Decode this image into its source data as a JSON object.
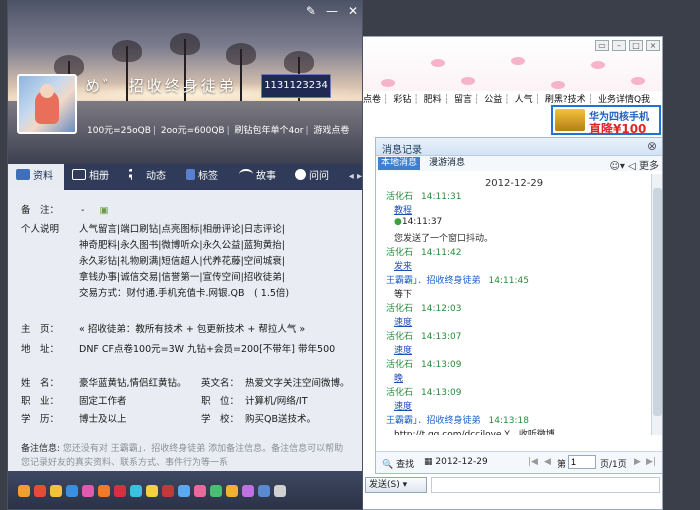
{
  "profile": {
    "nickname": "招收终身徒弟",
    "nick_prefix": "め゛",
    "qq_number": "1131123234",
    "signature": [
      "100元=25oQB",
      "2oo元=600QB",
      "刷钻包年单个4or",
      "游戏点卷"
    ],
    "tabs": [
      {
        "label": "资料",
        "icon": "profile-card-icon"
      },
      {
        "label": "相册",
        "icon": "photo-album-icon"
      },
      {
        "label": "动态",
        "icon": "feed-list-icon"
      },
      {
        "label": "标签",
        "icon": "tag-icon"
      },
      {
        "label": "故事",
        "icon": "story-signal-icon"
      },
      {
        "label": "问问",
        "icon": "question-icon"
      }
    ],
    "fields": {
      "note_label": "备　注：",
      "note_value": "-",
      "bio_label": "个人说明",
      "bio_lines": [
        "人气留言|端口刷钻|点亮图标|相册评论|日志评论|",
        "神奇肥料|永久图书|微博听众|永久公益|蓝狗黄抬|",
        "永久彩钻|礼物刷满|短信超人|代养花藤|空间城衰|",
        "拿钱办事|诚信交易|信誉第一|宣传空间|招收徒弟|",
        "交易方式：财付通.手机充值卡.网银.QB　( 1.5倍)"
      ],
      "homepage_label": "主　页：",
      "homepage_value": "« 招收徒弟：教所有技术 + 包更新技术 + 帮拉人气 »",
      "address_label": "地　址：",
      "address_value": "DNF CF点卷100元=3W 九钻+会员=200[不带年] 带年500",
      "name_label": "姓　名：",
      "name_value": "豪华蓝黄钻,情侣红黄钻。",
      "en_name_label": "英文名：",
      "en_name_value": "热爱文字关注空间微博。",
      "job_label": "职　业：",
      "job_value": "固定工作者",
      "position_label": "职　位：",
      "position_value": "计算机/网络/IT",
      "edu_label": "学　历：",
      "edu_value": "博士及以上",
      "school_label": "学　校：",
      "school_value": "购买QB送技术。",
      "remark_label": "备注信息:",
      "remark_text": "您还没有对 王霸霸」．招收终身徒弟 添加备注信息。备注信息可以帮助您记录好友的真实资料、联系方式、事件行为等一系"
    }
  },
  "chat": {
    "linkbar": [
      "点卷",
      "彩钻",
      "肥料",
      "留言",
      "公益",
      "人气",
      "刷黑?技术",
      "业务详情Q我"
    ],
    "ad": {
      "line1": "华为四核手机",
      "line2": "直降¥100"
    },
    "panel_title": "消息记录",
    "tab_local": "本地消息",
    "tab_roam": "漫游消息",
    "more": "更多",
    "date": "2012-12-29",
    "messages": [
      {
        "sender": "活化石",
        "time": "14:11:31",
        "body": "教程",
        "link": true,
        "color": "green"
      },
      {
        "sender": "",
        "time": "14:11:37",
        "body": "您发送了一个窗口抖动。",
        "link": false,
        "color": "system"
      },
      {
        "sender": "活化石",
        "time": "14:11:42",
        "body": "发来",
        "link": true,
        "color": "green"
      },
      {
        "sender": "王霸霸」．招收终身徒弟",
        "time": "14:11:45",
        "body": "等下",
        "link": false,
        "color": "blue"
      },
      {
        "sender": "活化石",
        "time": "14:12:03",
        "body": "速度",
        "link": true,
        "color": "green"
      },
      {
        "sender": "活化石",
        "time": "14:13:07",
        "body": "速度",
        "link": true,
        "color": "green"
      },
      {
        "sender": "活化石",
        "time": "14:13:09",
        "body": "晚",
        "link": true,
        "color": "green"
      },
      {
        "sender": "活化石",
        "time": "14:13:09",
        "body": "速度",
        "link": true,
        "color": "green"
      },
      {
        "sender": "王霸霸」．招收终身徒弟",
        "time": "14:13:18",
        "body": "http://t.qq.com/dccilove Y　收听微博",
        "link": false,
        "color": "blue"
      }
    ],
    "footer": {
      "search": "查找",
      "date": "2012-12-29",
      "page_prefix": "第",
      "page_value": "1",
      "page_suffix": "页/1页"
    },
    "send_label": "发送(S)"
  }
}
